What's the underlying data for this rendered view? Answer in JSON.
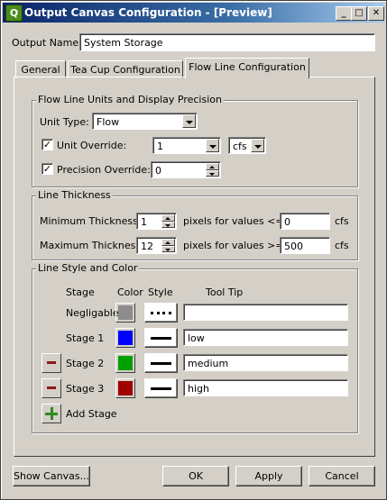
{
  "window": {
    "title": "Output Canvas Configuration - [Preview]",
    "minimize_glyph": "_",
    "maximize_glyph": "□",
    "close_glyph": "✕"
  },
  "output_name": {
    "label": "Output Name:",
    "value": "System Storage"
  },
  "tabs": [
    {
      "label": "General"
    },
    {
      "label": "Tea Cup Configuration"
    },
    {
      "label": "Flow Line Configuration",
      "active": true
    }
  ],
  "units_group": {
    "title": "Flow Line Units and Display Precision",
    "unit_type_label": "Unit Type:",
    "unit_type_value": "Flow",
    "unit_override_label": "Unit Override:",
    "unit_override_checked": true,
    "unit_override_value": "1",
    "unit_value": "cfs",
    "precision_override_label": "Precision Override:",
    "precision_override_checked": true,
    "precision_value": "0"
  },
  "thickness_group": {
    "title": "Line Thickness",
    "min_label": "Minimum Thickness:",
    "min_value": "1",
    "min_text": "pixels for values <=",
    "min_threshold": "0",
    "min_unit": "cfs",
    "max_label": "Maximum Thickness:",
    "max_value": "12",
    "max_text": "pixels for values >=",
    "max_threshold": "500",
    "max_unit": "cfs"
  },
  "style_group": {
    "title": "Line Style and Color",
    "headers": {
      "stage": "Stage",
      "color": "Color",
      "style": "Style",
      "tooltip": "Tool Tip"
    },
    "stages": [
      {
        "name": "Negligable",
        "color": "#8c8c8c",
        "style": "dotted",
        "tooltip": "",
        "removable": false
      },
      {
        "name": "Stage 1",
        "color": "#0000ff",
        "style": "solid",
        "tooltip": "low",
        "removable": false
      },
      {
        "name": "Stage 2",
        "color": "#00a000",
        "style": "solid",
        "tooltip": "medium",
        "removable": true
      },
      {
        "name": "Stage 3",
        "color": "#a00000",
        "style": "solid",
        "tooltip": "high",
        "removable": true
      }
    ],
    "add_stage_label": "Add Stage"
  },
  "buttons": {
    "show_canvas": "Show Canvas...",
    "ok": "OK",
    "apply": "Apply",
    "cancel": "Cancel"
  },
  "colors": {
    "titlebar_start": "#0a246a",
    "titlebar_end": "#a6caf0",
    "face": "#d4d0c8"
  }
}
